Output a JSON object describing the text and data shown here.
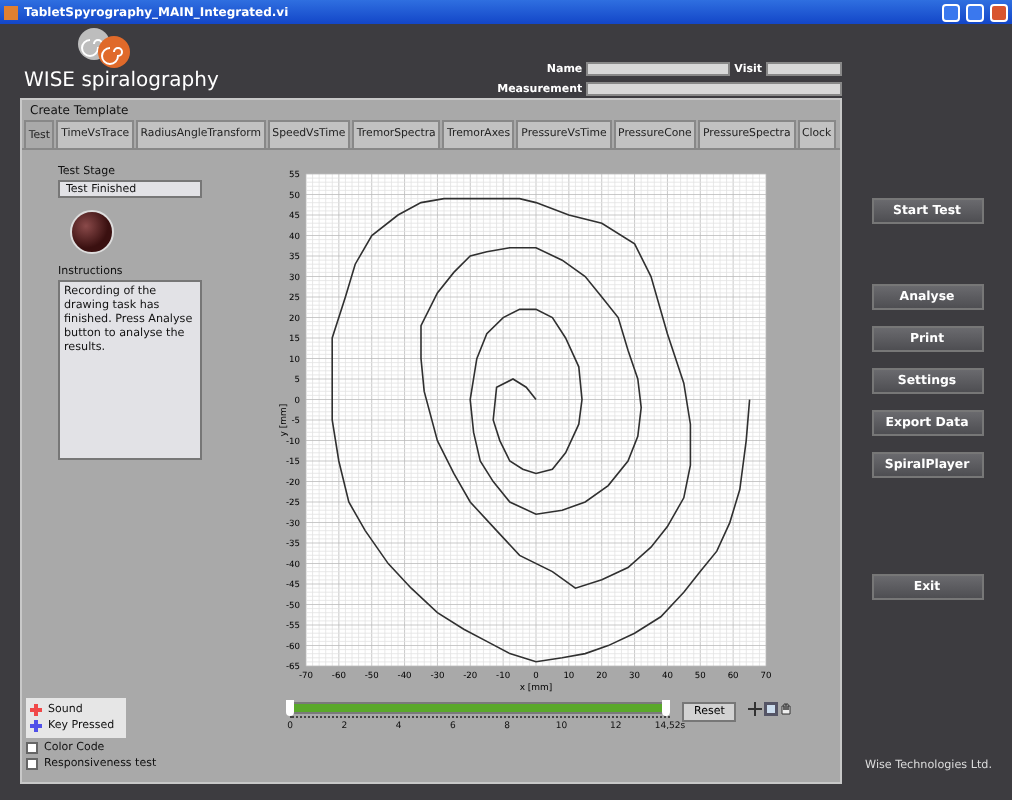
{
  "window": {
    "title": "TabletSpyrography_MAIN_Integrated.vi"
  },
  "logo": {
    "brand": "WISE",
    "name": "spiralography"
  },
  "header": {
    "name": {
      "label": "Name"
    },
    "visit": {
      "label": "Visit"
    },
    "measurement": {
      "label": "Measurement"
    }
  },
  "panel": {
    "title": "Create Template",
    "tabs": [
      {
        "label": "Test",
        "selected": true
      },
      {
        "label": "TimeVsTrace",
        "selected": false
      },
      {
        "label": "RadiusAngleTransform",
        "selected": false
      },
      {
        "label": "SpeedVsTime",
        "selected": false
      },
      {
        "label": "TremorSpectra",
        "selected": false
      },
      {
        "label": "TremorAxes",
        "selected": false
      },
      {
        "label": "PressureVsTime",
        "selected": false
      },
      {
        "label": "PressureCone",
        "selected": false
      },
      {
        "label": "PressureSpectra",
        "selected": false
      },
      {
        "label": "Clock",
        "selected": false
      }
    ],
    "test_stage": {
      "label": "Test Stage",
      "value": "Test Finished"
    },
    "indicator": {
      "on": false
    },
    "instructions": {
      "label": "Instructions",
      "value": "Recording of the drawing task has finished. Press Analyse button to analyse the results."
    },
    "chart_data": {
      "type": "line",
      "xlabel": "x [mm]",
      "ylabel": "y [mm]",
      "xlim": [
        -70,
        70
      ],
      "ylim": [
        -65,
        55
      ],
      "xticks": [
        -70,
        -60,
        -50,
        -40,
        -30,
        -20,
        -10,
        0,
        10,
        20,
        30,
        40,
        50,
        60,
        70
      ],
      "yticks": [
        -65,
        -60,
        -55,
        -50,
        -45,
        -40,
        -35,
        -30,
        -25,
        -20,
        -15,
        -10,
        -5,
        0,
        5,
        10,
        15,
        20,
        25,
        30,
        35,
        40,
        45,
        50,
        55
      ],
      "x": [
        0,
        -3,
        -7,
        -12,
        -13,
        -11,
        -8,
        -4,
        0,
        5,
        9,
        13,
        14,
        13,
        9,
        5,
        0,
        -5,
        -10,
        -15,
        -18,
        -20,
        -19,
        -17,
        -13,
        -8,
        0,
        8,
        15,
        22,
        28,
        31,
        32,
        31,
        28,
        25,
        20,
        15,
        8,
        0,
        -8,
        -15,
        -20,
        -25,
        -30,
        -35,
        -35,
        -34,
        -30,
        -25,
        -20,
        -12,
        -5,
        5,
        12,
        20,
        28,
        35,
        40,
        45,
        47,
        47,
        45,
        40,
        35,
        30,
        20,
        10,
        0,
        -5,
        -12,
        -20,
        -28,
        -35,
        -42,
        -50,
        -55,
        -58,
        -62,
        -62,
        -62,
        -60,
        -57,
        -52,
        -45,
        -38,
        -30,
        -22,
        -15,
        -8,
        0,
        8,
        15,
        22,
        30,
        38,
        45,
        50,
        55,
        59,
        62,
        64,
        65
      ],
      "grid": true,
      "series": [
        {
          "color": "#303030",
          "values": [
            0,
            3,
            5,
            3,
            -5,
            -10,
            -15,
            -17,
            -18,
            -17,
            -13,
            -6,
            0,
            8,
            15,
            20,
            22,
            22,
            20,
            16,
            10,
            0,
            -8,
            -15,
            -20,
            -25,
            -28,
            -27,
            -25,
            -21,
            -15,
            -9,
            -2,
            5,
            12,
            20,
            25,
            30,
            34,
            37,
            37,
            36,
            35,
            31,
            26,
            18,
            10,
            2,
            -10,
            -18,
            -25,
            -32,
            -38,
            -42,
            -46,
            -44,
            -41,
            -36,
            -31,
            -24,
            -16,
            -6,
            4,
            16,
            30,
            38,
            43,
            45,
            48,
            49,
            49,
            49,
            49,
            48,
            45,
            40,
            33,
            25,
            15,
            5,
            -5,
            -15,
            -25,
            -32,
            -40,
            -46,
            -52,
            -56,
            -59,
            -62,
            -64,
            -63,
            -62,
            -60,
            -57,
            -53,
            -47,
            -42,
            -37,
            -30,
            -22,
            -10,
            0
          ]
        }
      ]
    },
    "slider": {
      "level": 1,
      "ticks": [
        "0",
        "2",
        "4",
        "6",
        "8",
        "10",
        "12",
        "14,52s"
      ]
    },
    "reset": "Reset",
    "legend": [
      {
        "label": "Sound",
        "color": "#f04848"
      },
      {
        "label": "Key Pressed",
        "color": "#5050e8"
      }
    ],
    "checkboxes": [
      {
        "label": "Color Code",
        "checked": false
      },
      {
        "label": "Responsiveness test",
        "checked": false
      }
    ]
  },
  "button_groups": [
    [
      "Start Test"
    ],
    [
      "Analyse",
      "Print",
      "Settings",
      "Export Data",
      "SpiralPlayer"
    ],
    [
      "Exit"
    ]
  ],
  "footer": "Wise Technologies Ltd."
}
